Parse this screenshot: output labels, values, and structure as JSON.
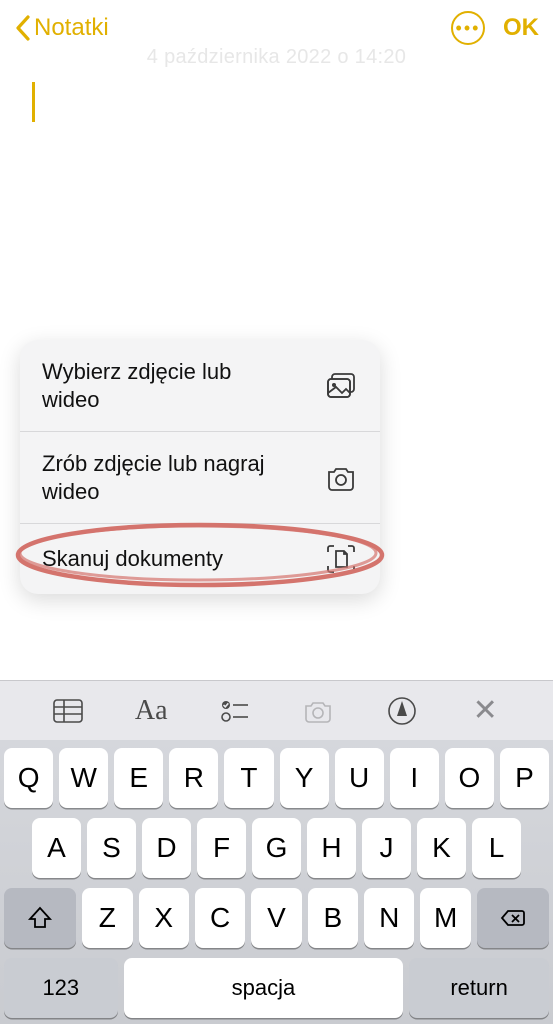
{
  "header": {
    "back_label": "Notatki",
    "ok_label": "OK"
  },
  "note": {
    "timestamp": "4 października 2022 o 14:20"
  },
  "menu": {
    "items": [
      {
        "label": "Wybierz zdjęcie lub wideo"
      },
      {
        "label": "Zrób zdjęcie lub nagraj wideo"
      },
      {
        "label": "Skanuj dokumenty"
      }
    ]
  },
  "keyboard": {
    "row1": [
      "Q",
      "W",
      "E",
      "R",
      "T",
      "Y",
      "U",
      "I",
      "O",
      "P"
    ],
    "row2": [
      "A",
      "S",
      "D",
      "F",
      "G",
      "H",
      "J",
      "K",
      "L"
    ],
    "row3": [
      "Z",
      "X",
      "C",
      "V",
      "B",
      "N",
      "M"
    ],
    "numkey": "123",
    "space": "spacja",
    "return": "return"
  }
}
